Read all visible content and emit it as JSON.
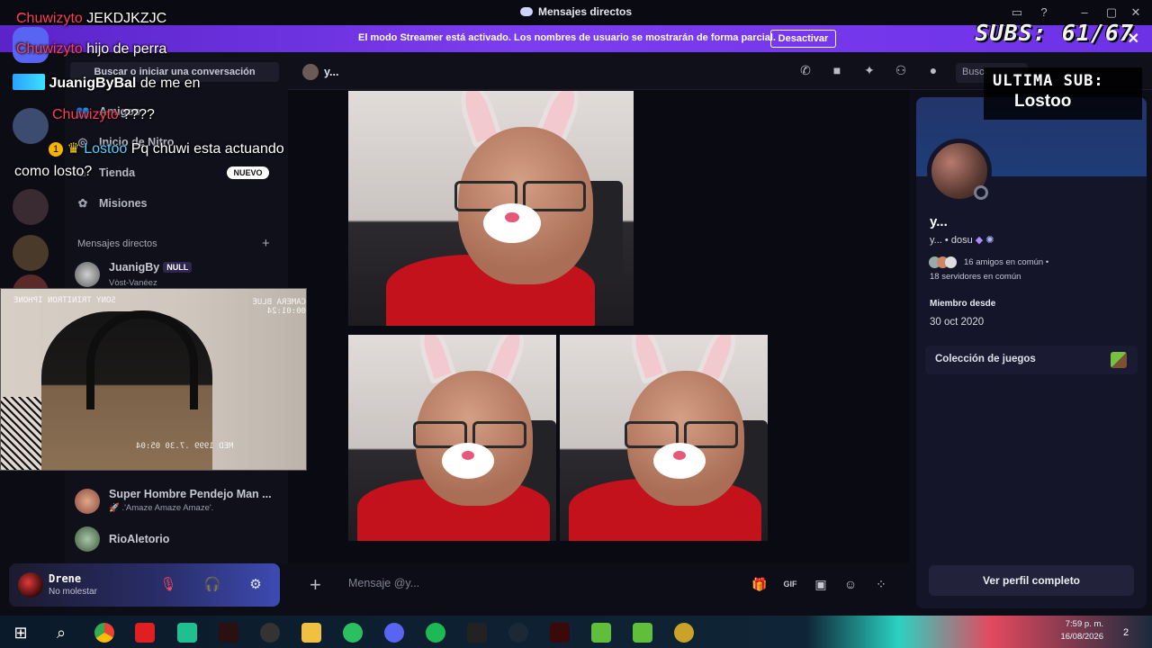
{
  "window": {
    "title": "Mensajes directos",
    "title_icon": "discord-icon"
  },
  "banner": {
    "text": "El modo Streamer está activado. Los nombres de usuario se mostrarán de forma parcial.",
    "button": "Desactivar"
  },
  "overlay": {
    "subs": "SUBS: 61/67",
    "last_sub_heading": "ULTIMA SUB:",
    "last_sub_value": "Lostoo",
    "chat": [
      {
        "user": "Chuwizyto",
        "user_color": "#ff3e5a",
        "message": "JEKDJKZJC"
      },
      {
        "user": "Chuwizyto",
        "user_color": "#ff3e5a",
        "message": "hijo de perra"
      },
      {
        "user": "JuanigByBal",
        "user_color": "#ffffff",
        "message": "de me en"
      },
      {
        "user": "Chuwizyto",
        "user_color": "#ff3e5a",
        "message": "????"
      },
      {
        "user": "Lostoo",
        "user_color": "#4fd3ff",
        "message": "Pq chuwi esta actuando"
      },
      {
        "user": "",
        "user_color": "#ffffff",
        "message": "como losto?"
      }
    ]
  },
  "sidebar": {
    "search_button": "Buscar o iniciar una conversación",
    "nav": [
      {
        "label": "Amigos",
        "icon": "friends-icon"
      },
      {
        "label": "Inicio de Nitro",
        "icon": "nitro-icon"
      },
      {
        "label": "Tienda",
        "icon": "shop-icon",
        "badge": "NUEVO"
      },
      {
        "label": "Misiones",
        "icon": "quests-icon"
      }
    ],
    "dm_header": "Mensajes directos",
    "dms": [
      {
        "name": "JuanigBy",
        "tag": "NULL",
        "status": "Vòst-Vanéez"
      },
      {
        "name": "Super Hombre Pendejo Man ...",
        "status": "🚀 .'Amaze Amaze Amaze'."
      },
      {
        "name": "RioAletorio",
        "status": ""
      }
    ]
  },
  "user_panel": {
    "name": "Drene",
    "status": "No molestar"
  },
  "dm_header": {
    "name": "y...",
    "search_placeholder": "Busc"
  },
  "chat_input": {
    "placeholder": "Mensaje @y..."
  },
  "profile": {
    "name": "y...",
    "handle": "y...",
    "pronoun": "dosu",
    "mutual_friends": "16 amigos en común",
    "mutual_servers": "18 servidores en común",
    "member_since_label": "Miembro desde",
    "member_since": "30 oct 2020",
    "games_label": "Colección de juegos",
    "full_profile_button": "Ver perfil completo"
  },
  "webcam": {
    "hud_top_left": "SONY TRINITRON IPHONE",
    "hud_top_right": "CAMERA BLUE 00:01:24",
    "hud_bottom": "MED 1999 .7.30 05:04"
  },
  "taskbar": {
    "time": "7:59 p. m.",
    "date": "16/08/2026",
    "notifications": "2"
  },
  "colors": {
    "banner": "#6e32e6",
    "accent": "#5865f2",
    "hoodie": "#c3121c"
  }
}
